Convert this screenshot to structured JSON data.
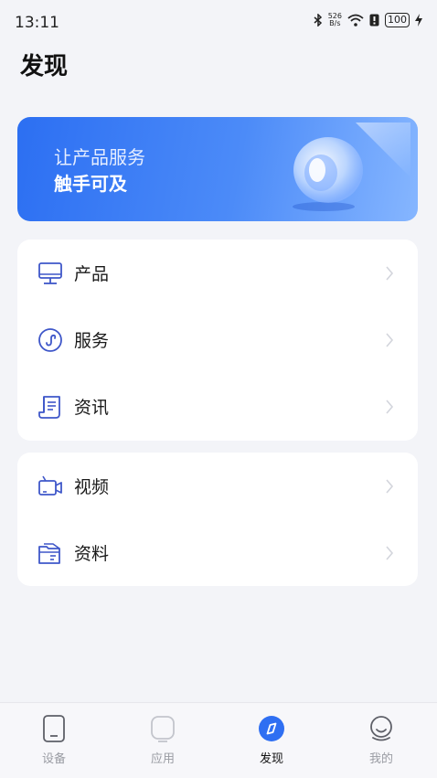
{
  "status_bar": {
    "time": "13:11",
    "net_speed_value": "526",
    "net_speed_unit": "B/s",
    "battery": "100",
    "icons": [
      "bluetooth-icon",
      "wifi-icon",
      "sim-icon",
      "battery-icon",
      "charging-icon"
    ]
  },
  "page": {
    "title": "发现"
  },
  "banner": {
    "line1": "让产品服务",
    "line2": "触手可及"
  },
  "list_group_1": {
    "items": [
      {
        "label": "产品",
        "icon": "monitor-icon"
      },
      {
        "label": "服务",
        "icon": "service-icon"
      },
      {
        "label": "资讯",
        "icon": "news-icon"
      }
    ]
  },
  "list_group_2": {
    "items": [
      {
        "label": "视频",
        "icon": "video-icon"
      },
      {
        "label": "资料",
        "icon": "folder-icon"
      }
    ]
  },
  "tab_bar": {
    "active": "发现",
    "tabs": [
      {
        "label": "设备",
        "icon": "device-icon"
      },
      {
        "label": "应用",
        "icon": "apps-icon"
      },
      {
        "label": "发现",
        "icon": "compass-icon"
      },
      {
        "label": "我的",
        "icon": "profile-icon"
      }
    ]
  },
  "colors": {
    "accent": "#2f6ff2",
    "icon_stroke": "#3f57c9",
    "background": "#f3f4f8"
  }
}
